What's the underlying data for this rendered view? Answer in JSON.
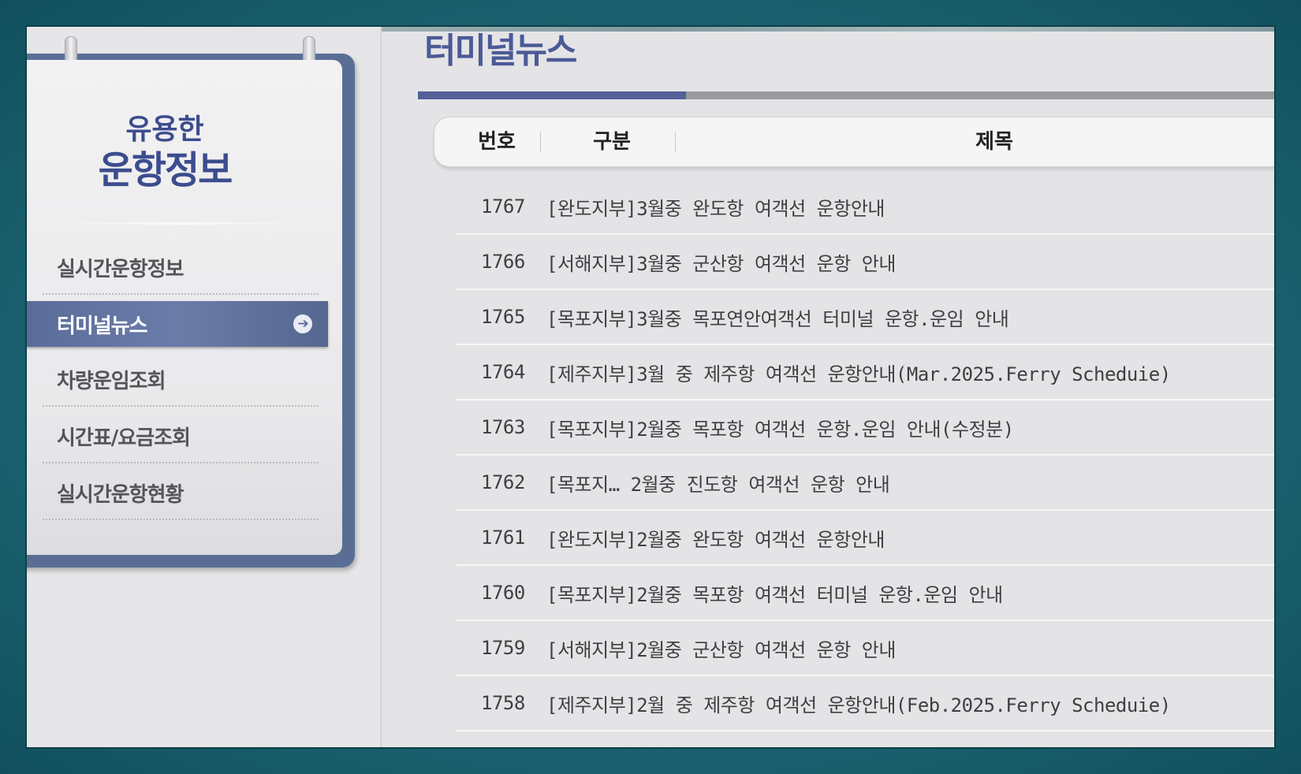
{
  "sidebar": {
    "title_line1": "유용한",
    "title_line2": "운항정보",
    "items": [
      {
        "label": "실시간운항정보"
      },
      {
        "label": "터미널뉴스"
      },
      {
        "label": "차량운임조회"
      },
      {
        "label": "시간표/요금조회"
      },
      {
        "label": "실시간운항현황"
      }
    ],
    "active_index": 1,
    "accent_color": "#5a6c99"
  },
  "main": {
    "page_title": "터미널뉴스",
    "columns": {
      "number": "번호",
      "category": "구분",
      "title": "제목"
    },
    "rows": [
      {
        "num": "1767",
        "title": "[완도지부]3월중 완도항 여객선 운항안내"
      },
      {
        "num": "1766",
        "title": "[서해지부]3월중 군산항 여객선 운항 안내"
      },
      {
        "num": "1765",
        "title": "[목포지부]3월중 목포연안여객선 터미널 운항.운임 안내"
      },
      {
        "num": "1764",
        "title": "[제주지부]3월 중 제주항 여객선 운항안내(Mar.2025.Ferry Scheduie)"
      },
      {
        "num": "1763",
        "title": "[목포지부]2월중 목포항 여객선 운항.운임 안내(수정분)"
      },
      {
        "num": "1762",
        "title": "[목포지… 2월중 진도항 여객선 운항 안내"
      },
      {
        "num": "1761",
        "title": "[완도지부]2월중 완도항 여객선 운항안내"
      },
      {
        "num": "1760",
        "title": "[목포지부]2월중 목포항 여객선 터미널 운항.운임 안내"
      },
      {
        "num": "1759",
        "title": "[서해지부]2월중 군산항 여객선 운항 안내"
      },
      {
        "num": "1758",
        "title": "[제주지부]2월 중 제주항 여객선 운항안내(Feb.2025.Ferry Scheduie)"
      }
    ]
  },
  "icons": {
    "active_menu_arrow": "arrow-right-circle-icon"
  },
  "colors": {
    "title_blue": "#4b5a96",
    "background_teal": "#1e6a78"
  }
}
